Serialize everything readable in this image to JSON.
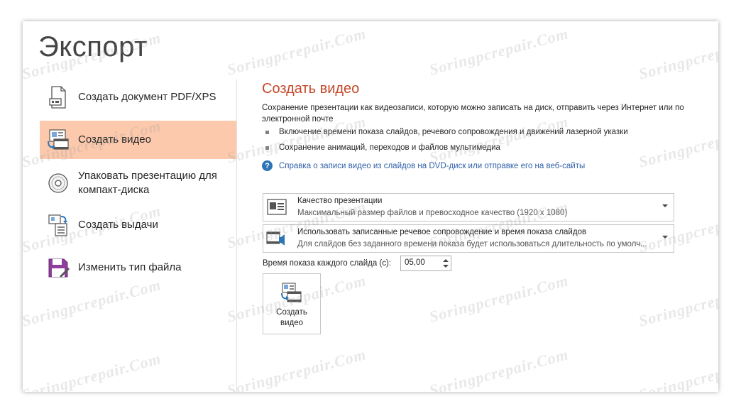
{
  "page": {
    "title": "Экспорт"
  },
  "nav": {
    "items": [
      {
        "label": "Создать документ PDF/XPS",
        "icon": "pdf-document-icon",
        "selected": false
      },
      {
        "label": "Создать видео",
        "icon": "video-slides-icon",
        "selected": true
      },
      {
        "label": "Упаковать презентацию для\nкомпакт-диска",
        "icon": "cd-disc-icon",
        "selected": false
      },
      {
        "label": "Создать выдачи",
        "icon": "handouts-icon",
        "selected": false
      },
      {
        "label": "Изменить тип файла",
        "icon": "floppy-save-icon",
        "selected": false
      }
    ],
    "selected_color": "#fcc9ad"
  },
  "detail": {
    "title": "Создать видео",
    "title_color": "#c5482b",
    "description": "Сохранение презентации как видеозаписи, которую можно записать на диск, отправить через Интернет или по электронной почте",
    "bullets": [
      "Включение времени показа слайдов, речевого сопровождения и движений лазерной указки",
      "Сохранение анимаций, переходов и файлов мультимедиа"
    ],
    "help_link": "Справка о записи видео из слайдов на DVD-диск или отправке его на веб-сайты",
    "quality": {
      "title": "Качество презентации",
      "subtitle": "Максимальный размер файлов и превосходное качество (1920 x 1080)"
    },
    "narration": {
      "title": "Использовать записанные речевое сопровождение и время показа слайдов",
      "subtitle": "Для слайдов без заданного времени показа будет использоваться длительность по умолч..."
    },
    "slide_time": {
      "label": "Время показа каждого слайда (с):",
      "value": "05,00"
    },
    "create_button": "Создать\nвидео"
  },
  "watermark": "Soringpcrepair.Com"
}
